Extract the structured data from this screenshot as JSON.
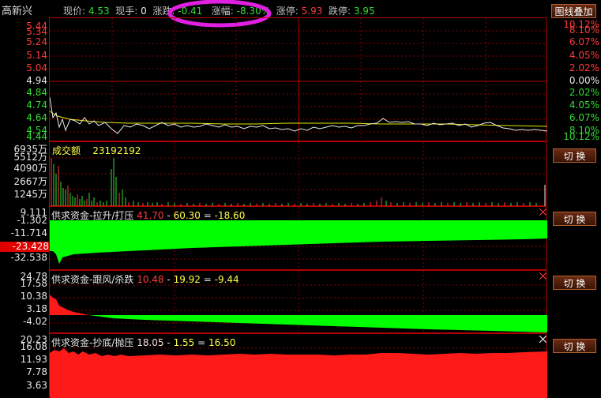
{
  "header": {
    "stock_name": "高新兴",
    "price_label": "现价:",
    "price_value": "4.53",
    "volume_label": "现手:",
    "volume_value": "0",
    "change_label": "涨跌:",
    "change_value": "-0.41",
    "change_pct_label": "涨幅:",
    "change_pct_value": "-8.30%",
    "limit_up_label": "涨停:",
    "limit_up_value": "5.93",
    "limit_down_label": "跌停:",
    "limit_down_value": "3.95",
    "overlay_button": "图线叠加"
  },
  "price_panel": {
    "left_axis": [
      "5.44",
      "5.34",
      "5.24",
      "5.14",
      "5.04",
      "4.94",
      "4.84",
      "4.74",
      "4.64",
      "4.54",
      "4.44"
    ],
    "right_axis": [
      "10.12%",
      "8.10%",
      "6.07%",
      "4.05%",
      "2.02%",
      "0.00%",
      "2.02%",
      "4.05%",
      "6.07%",
      "8.10%",
      "10.12%"
    ]
  },
  "volume_panel": {
    "title_label": "成交额",
    "title_value": "23192192",
    "left_axis": [
      "6935万",
      "5512万",
      "4090万",
      "2667万",
      "1245万"
    ],
    "switch_button": "切 换"
  },
  "ind1": {
    "name": "供求资金-拉升/打压",
    "v1": "41.70",
    "minus": "-",
    "v2": "60.30",
    "eq": "=",
    "result": "-18.60",
    "left_axis": [
      "9.111",
      "-1.302",
      "-11.714",
      "-23.428",
      "-32.538"
    ],
    "switch_button": "切 换"
  },
  "ind2": {
    "name": "供求资金-跟风/杀跌",
    "v1": "10.48",
    "minus": "-",
    "v2": "19.92",
    "eq": "=",
    "result": "-9.44",
    "left_axis": [
      "24.78",
      "17.58",
      "10.38",
      "3.18",
      "-4.02"
    ],
    "switch_button": "切 换"
  },
  "ind3": {
    "name": "供求资金-抄底/抛压",
    "v1": "18.05",
    "minus": "-",
    "v2": "1.55",
    "eq": "=",
    "result": "16.50",
    "left_axis": [
      "20.23",
      "16.08",
      "11.93",
      "7.78",
      "3.63"
    ],
    "switch_button": "切 换"
  },
  "colors": {
    "up": "#ff3a3a",
    "down": "#33dd33",
    "frame": "#b00000",
    "highlight_ring": "#e020e0"
  }
}
